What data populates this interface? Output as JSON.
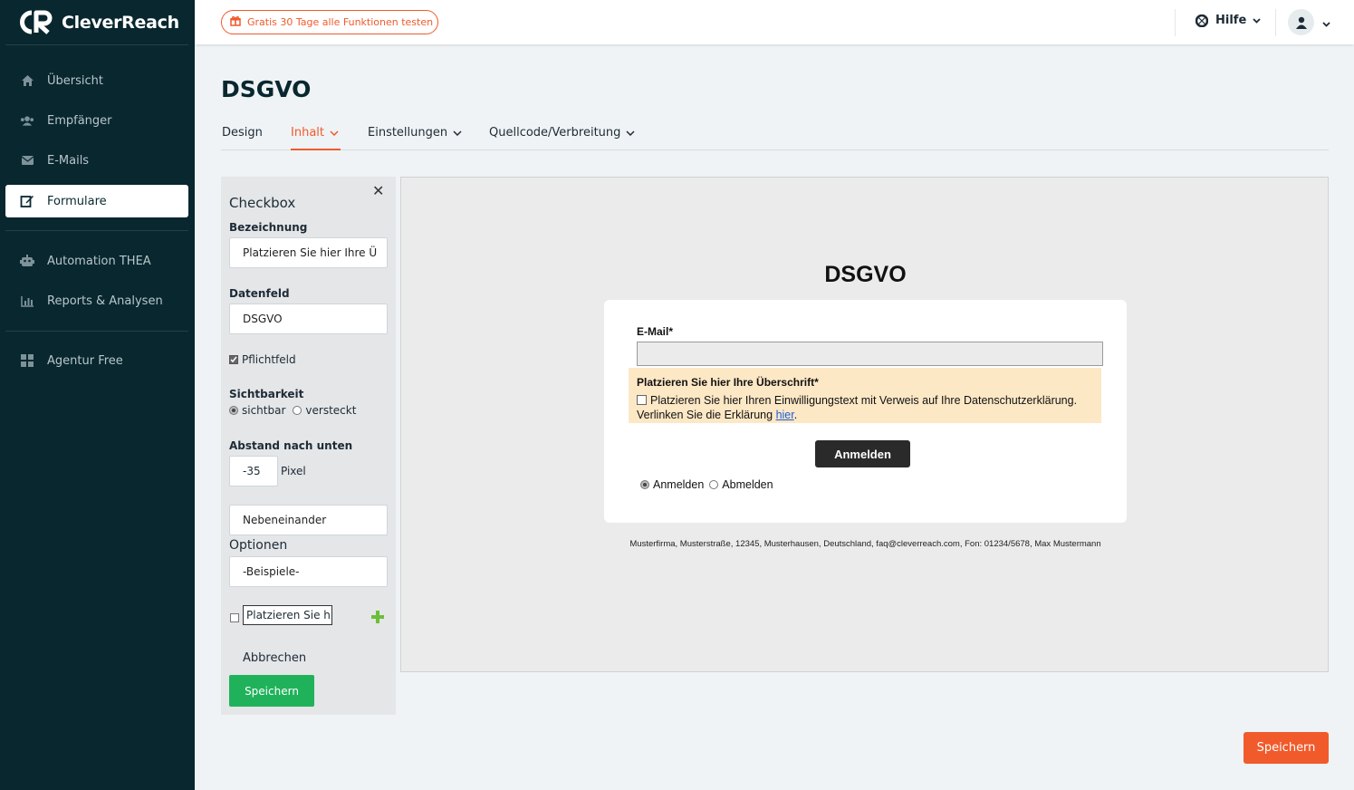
{
  "app": {
    "brand": "CleverReach"
  },
  "sidebar": {
    "items": [
      {
        "label": "Übersicht",
        "icon": "home-icon"
      },
      {
        "label": "Empfänger",
        "icon": "users-icon"
      },
      {
        "label": "E-Mails",
        "icon": "envelope-icon"
      },
      {
        "label": "Formulare",
        "icon": "edit-form-icon",
        "active": true
      },
      {
        "label": "Automation THEA",
        "icon": "robot-icon"
      },
      {
        "label": "Reports & Analysen",
        "icon": "chart-icon"
      },
      {
        "label": "Agentur Free",
        "icon": "grid-icon"
      }
    ]
  },
  "topbar": {
    "trial_label": "Gratis 30 Tage alle Funktionen testen",
    "help_label": "Hilfe"
  },
  "page": {
    "title": "DSGVO",
    "tabs": [
      {
        "label": "Design"
      },
      {
        "label": "Inhalt",
        "active": true
      },
      {
        "label": "Einstellungen"
      },
      {
        "label": "Quellcode/Verbreitung"
      }
    ]
  },
  "panel": {
    "title": "Checkbox",
    "bezeichnung_label": "Bezeichnung",
    "bezeichnung_value": "Platzieren Sie hier Ihre Ü",
    "datenfeld_label": "Datenfeld",
    "datenfeld_value": "DSGVO",
    "pflichtfeld_label": "Pflichtfeld",
    "pflichtfeld_checked": true,
    "sichtbarkeit_label": "Sichtbarkeit",
    "sichtbar_label": "sichtbar",
    "versteckt_label": "versteckt",
    "abstand_label": "Abstand nach unten",
    "abstand_value": "-35",
    "pixel_label": "Pixel",
    "layout_value": "Nebeneinander",
    "optionen_label": "Optionen",
    "beispiele_value": "-Beispiele-",
    "option_value": "Platzieren Sie h",
    "cancel_label": "Abbrechen",
    "save_label": "Speichern"
  },
  "preview": {
    "title": "DSGVO",
    "email_label": "E-Mail*",
    "consent_heading": "Platzieren Sie hier Ihre Überschrift*",
    "consent_text": "Platzieren Sie hier Ihren Einwilligungstext mit Verweis auf Ihre Datenschutzerklärung. Verlinken Sie die Erklärung ",
    "consent_link": "hier",
    "consent_end": ".",
    "submit_label": "Anmelden",
    "radio_anmelden": "Anmelden",
    "radio_abmelden": "Abmelden",
    "footer": "Musterfirma, Musterstraße, 12345, Musterhausen, Deutschland, faq@cleverreach.com, Fon: 01234/5678, Max Mustermann"
  },
  "actions": {
    "save_label": "Speichern"
  },
  "colors": {
    "sidebar_bg": "#08272f",
    "accent": "#f15a2b",
    "green": "#1fb25a"
  }
}
